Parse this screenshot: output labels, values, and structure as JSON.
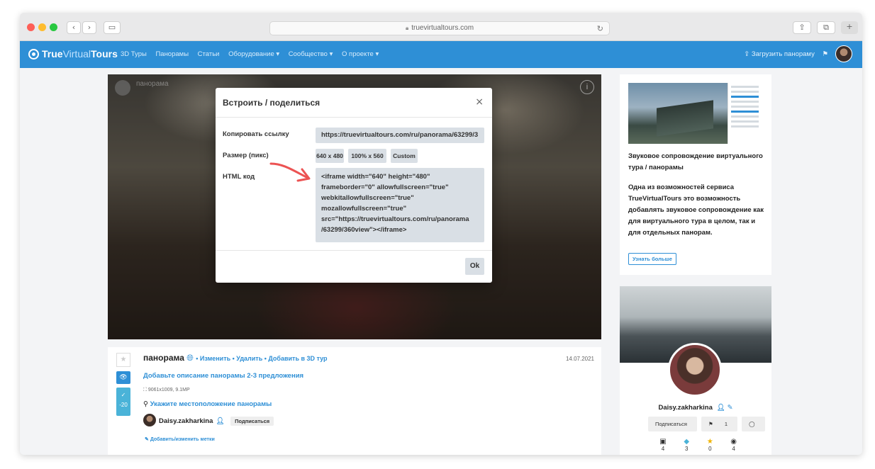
{
  "browser": {
    "url": "truevirtualtours.com",
    "back_icon": "chevron-left-icon",
    "forward_icon": "chevron-right-icon"
  },
  "navbar": {
    "logo_prefix": "True",
    "logo_mid": "Virtual",
    "logo_suffix": "Tours",
    "links": [
      "3D Туры",
      "Панорамы",
      "Статьи",
      "Оборудование ▾",
      "Сообщество ▾",
      "О проекте ▾"
    ],
    "upload_label": "⇪ Загрузить панораму",
    "accent_color": "#2e8fd6"
  },
  "viewer": {
    "title": "панорама"
  },
  "modal": {
    "title": "Встроить / поделиться",
    "close": "×",
    "copy_link_label": "Копировать ссылку",
    "copy_link_value": "https://truevirtualtours.com/ru/panorama/63299/3",
    "size_label": "Размер (пикс)",
    "size_options": [
      "640 x 480",
      "100% x 560",
      "Custom"
    ],
    "html_code_label": "HTML код",
    "html_code": "<iframe width=\"640\" height=\"480\"\nframeborder=\"0\" allowfullscreen=\"true\"\nwebkitallowfullscreen=\"true\"\nmozallowfullscreen=\"true\"\nsrc=\"https://truevirtualtours.com/ru/panorama\n/63299/360view\"></iframe>",
    "ok_label": "Ok"
  },
  "panorama_info": {
    "title": "панорама",
    "actions": "• Изменить • Удалить • Добавить в 3D тур",
    "date": "14.07.2021",
    "description_link": "Добавьте описание панорамы 2-3 предложения",
    "resolution": "⛶ 9061x1009, 9.1MP",
    "location_link": "Укажите местоположение панорамы",
    "author": "Daisy.zakharkina",
    "subscribe": "Подписаться",
    "tags_link": "Добавить/изменить метки",
    "vote_value": "-20"
  },
  "sidebar_card": {
    "title": "Звуковое сопровождение виртуального тура / панорамы",
    "text": "Одна из возможностей сервиса TrueVirtualTours это возможность добавлять звуковое сопровождение как для виртуального тура в целом, так и для отдельных панорам.",
    "button": "Узнать больше"
  },
  "profile_card": {
    "name": "Daisy.zakharkina",
    "subscribe": "Подписаться",
    "tag_count": "1",
    "stats": [
      "4",
      "3",
      "0",
      "4"
    ]
  }
}
